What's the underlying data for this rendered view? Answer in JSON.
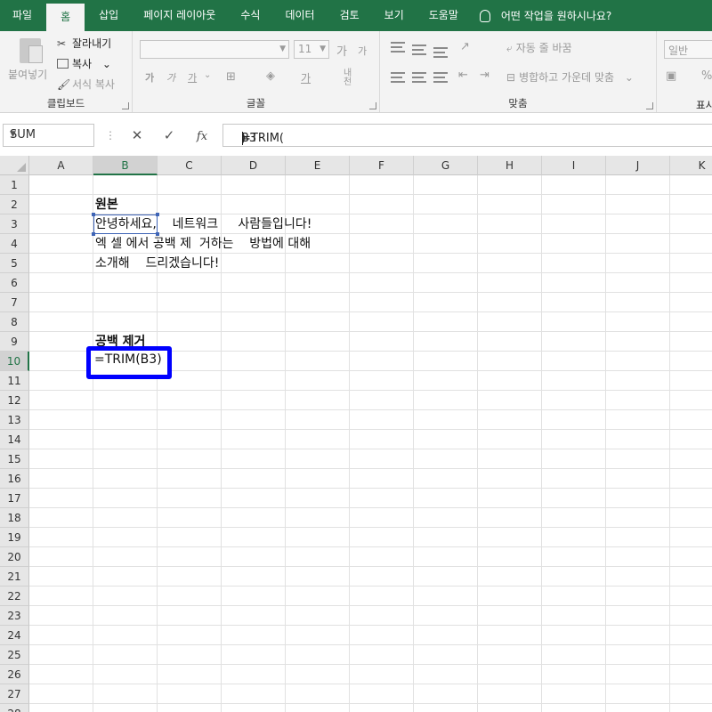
{
  "menu": {
    "tabs": [
      "파일",
      "홈",
      "삽입",
      "페이지 레이아웃",
      "수식",
      "데이터",
      "검토",
      "보기",
      "도움말"
    ],
    "active_tab": "홈",
    "tell_me": "어떤 작업을 원하시나요?"
  },
  "ribbon": {
    "clipboard": {
      "paste": "붙여넣기",
      "cut": "잘라내기",
      "copy": "복사",
      "copy_arrow": "⌄",
      "format_painter": "서식 복사",
      "label": "클립보드"
    },
    "font": {
      "size": "11",
      "grow": "가",
      "shrink": "가",
      "bold": "가",
      "italic": "가",
      "underline": "가",
      "underline_arrow": "⌄",
      "color_char": "가",
      "phonetic": "내천",
      "label": "글꼴"
    },
    "alignment": {
      "wrap_text": "자동 줄 바꿈",
      "merge_center": "병합하고 가운데 맞춤",
      "merge_arrow": "⌄",
      "label": "맞춤"
    },
    "number": {
      "format": "일반",
      "percent": "%",
      "label": "표시"
    }
  },
  "formula_bar": {
    "name_box": "SUM",
    "cancel_icon": "✕",
    "enter_icon": "✓",
    "fx": "fx",
    "formula_prefix": "=TRIM(",
    "formula_ref": "B3",
    "formula_suffix": ")"
  },
  "sheet": {
    "columns": [
      "A",
      "B",
      "C",
      "D",
      "E",
      "F",
      "G",
      "H",
      "I",
      "J",
      "K"
    ],
    "selected_column": "B",
    "rows": [
      "1",
      "2",
      "3",
      "4",
      "5",
      "6",
      "7",
      "8",
      "9",
      "10",
      "11",
      "12",
      "13",
      "14",
      "15",
      "16",
      "17",
      "18",
      "19",
      "20",
      "21",
      "22",
      "23",
      "24",
      "25",
      "26",
      "27",
      "28"
    ],
    "selected_row": "10",
    "cells": {
      "B2": "원본",
      "B3": "안녕하세요,    네트워크     사람들입니다!",
      "B4": "엑 셀 에서 공백 제  거하는    방법에 대해",
      "B5": "소개해    드리겠습니다!",
      "B9": "공백 제거",
      "B10": "=TRIM(B3)"
    }
  },
  "colors": {
    "brand": "#217346",
    "reference": "#3e64b6",
    "edit_highlight": "#0000ff"
  }
}
